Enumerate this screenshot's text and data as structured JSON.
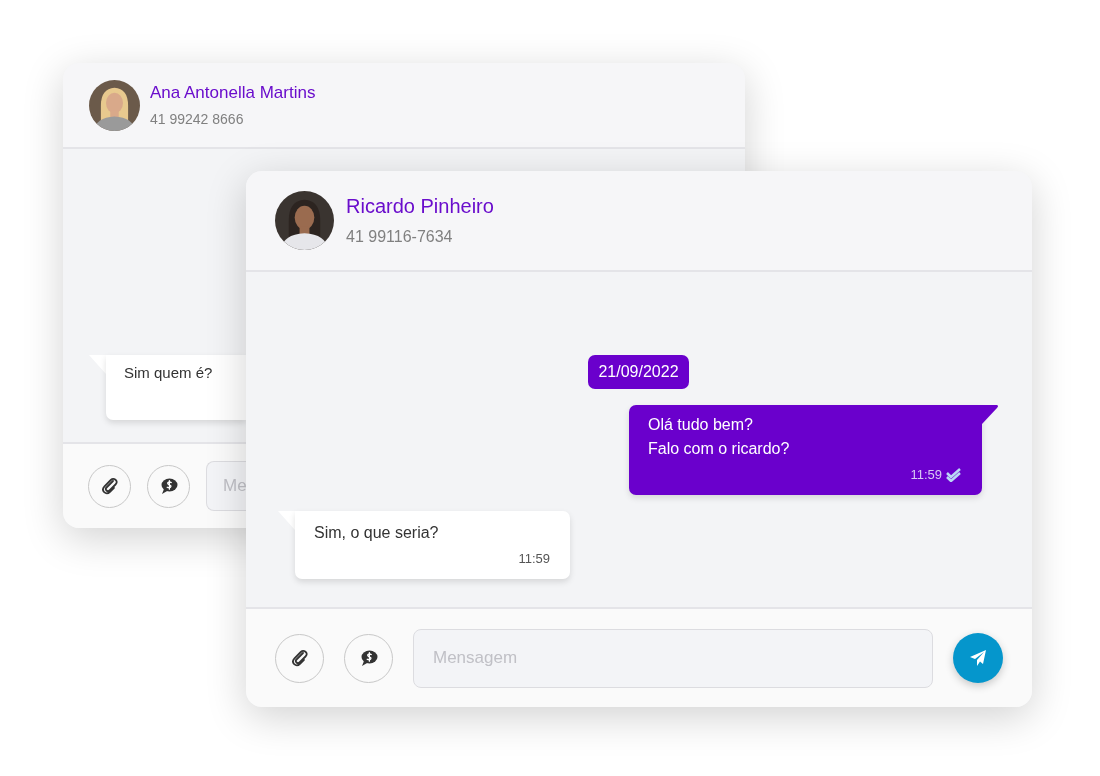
{
  "windows": [
    {
      "contact": {
        "name": "Ana Antonella Martins",
        "phone": "41 99242 8666"
      },
      "messages": [
        {
          "kind": "incoming",
          "text": "Sim quem é?"
        }
      ],
      "composer": {
        "placeholder": "Me"
      }
    },
    {
      "contact": {
        "name": "Ricardo Pinheiro",
        "phone": "41 99116-7634"
      },
      "date_chip": "21/09/2022",
      "messages": [
        {
          "kind": "outgoing",
          "text": "Olá tudo bem?\nFalo com o ricardo?",
          "time": "11:59",
          "read": true
        },
        {
          "kind": "incoming",
          "text": "Sim, o que seria?",
          "time": "11:59"
        }
      ],
      "composer": {
        "placeholder": "Mensagem",
        "send_button": true
      }
    }
  ]
}
